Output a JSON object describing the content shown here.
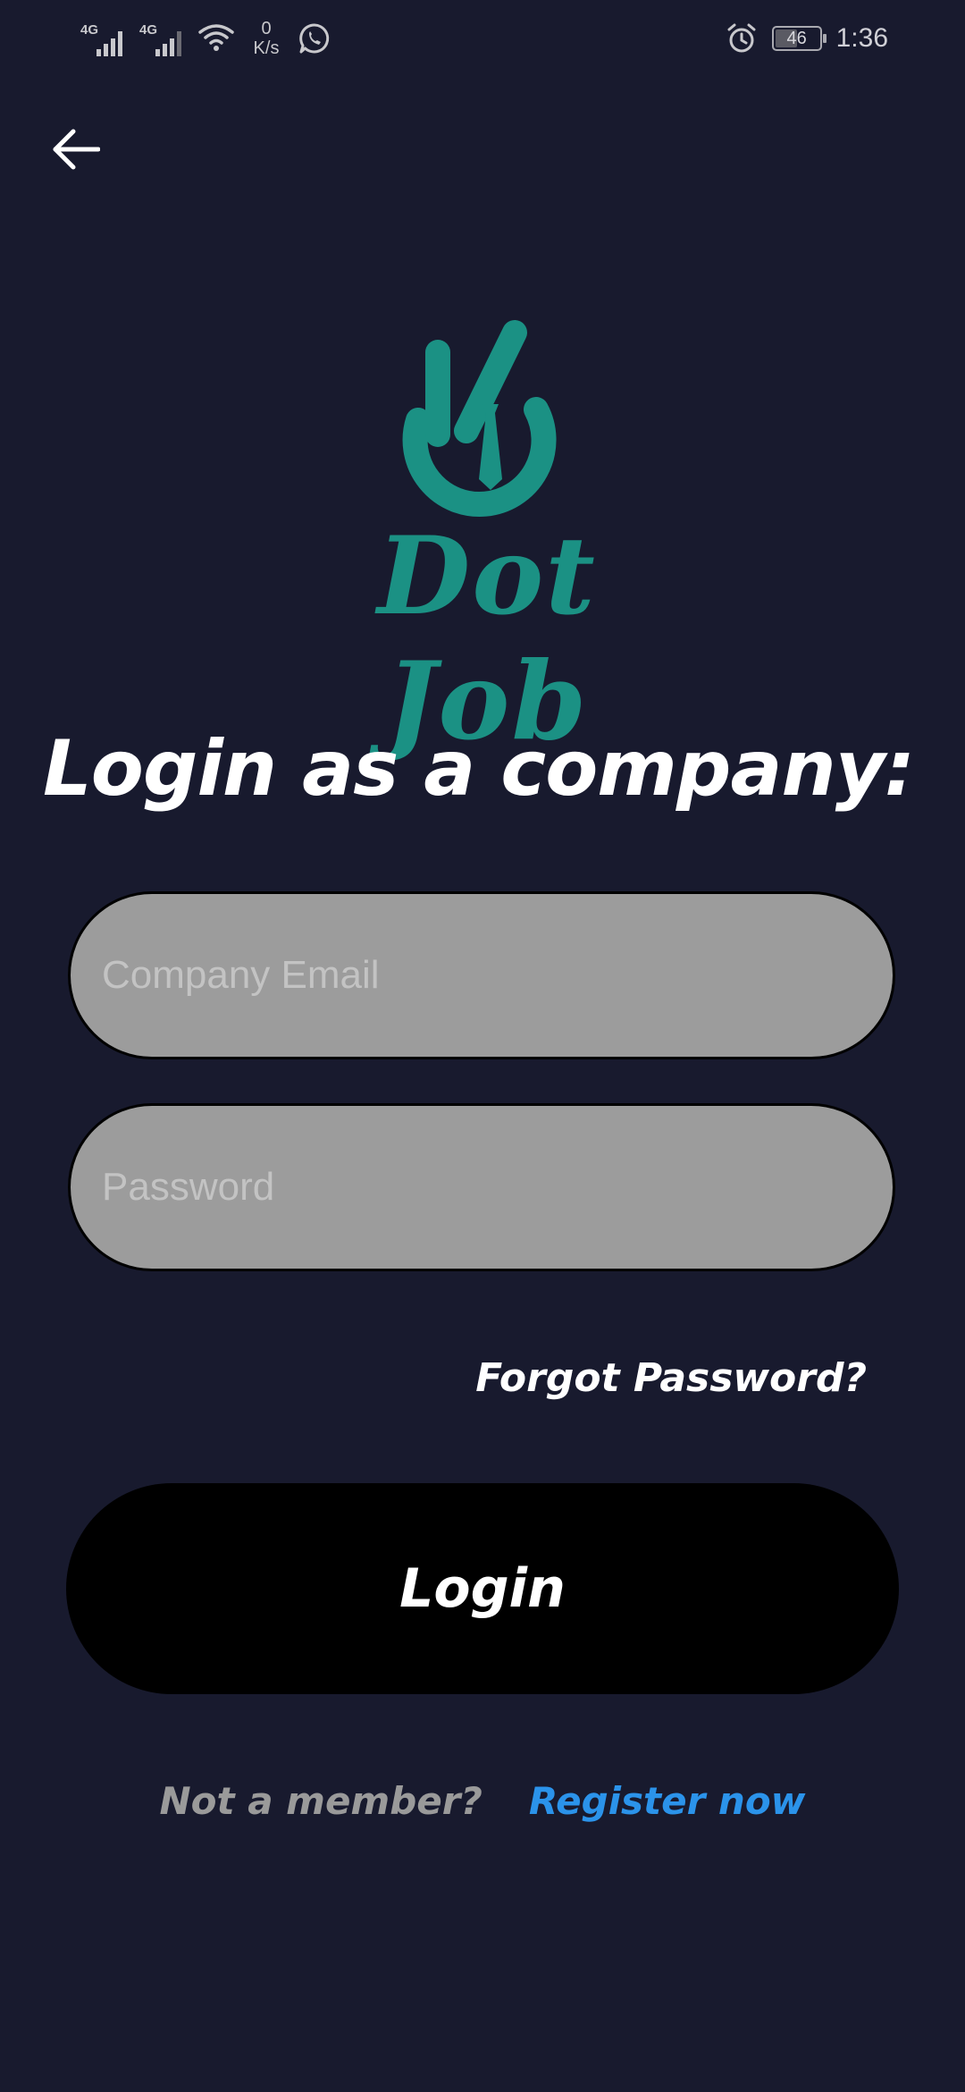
{
  "status_bar": {
    "sim1_tag": "4G",
    "sim2_tag": "4G",
    "net_speed_value": "0",
    "net_speed_unit": "K/s",
    "battery_level": "46",
    "time": "1:36",
    "icons": [
      "signal-icon",
      "signal-icon",
      "wifi-icon",
      "whatsapp-icon",
      "alarm-icon",
      "battery-icon"
    ]
  },
  "logo": {
    "text": "Dot Job",
    "color": "#1b9184"
  },
  "page": {
    "title": "Login as a company:"
  },
  "form": {
    "email_placeholder": "Company Email",
    "email_value": "",
    "password_placeholder": "Password",
    "password_value": "",
    "forgot_label": "Forgot Password?",
    "login_label": "Login"
  },
  "footer": {
    "not_member_label": "Not a member?",
    "register_label": "Register now",
    "register_color": "#2b93ea"
  },
  "colors": {
    "background": "#181a2e",
    "input_fill": "#9c9c9c",
    "button_fill": "#000000"
  }
}
